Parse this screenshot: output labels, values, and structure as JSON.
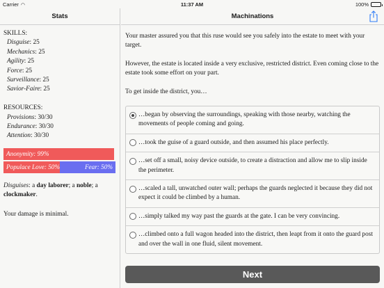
{
  "status_bar": {
    "carrier": "Carrier",
    "time": "11:37 AM",
    "battery": "100%"
  },
  "left": {
    "title": "Stats",
    "skills_title": "SKILLS:",
    "skills": [
      {
        "name": "Disguise",
        "value": ": 25"
      },
      {
        "name": "Mechanics",
        "value": ": 25"
      },
      {
        "name": "Agility",
        "value": ": 25"
      },
      {
        "name": "Force",
        "value": ": 25"
      },
      {
        "name": "Surveillance",
        "value": ": 25"
      },
      {
        "name": "Savior-Faire",
        "value": ": 25"
      }
    ],
    "resources_title": "RESOURCES:",
    "resources": [
      {
        "name": "Provisions",
        "value": ": 30/30"
      },
      {
        "name": "Endurance",
        "value": ": 30/30"
      },
      {
        "name": "Attention",
        "value": ": 30/30"
      }
    ],
    "bars": {
      "anonymity": {
        "label": "Anonymity: 99%",
        "value": 0.99,
        "color": "#f05a5a"
      },
      "populace": {
        "left_label": "Populace Love: 50%",
        "right_label": "Fear: 50%",
        "value": 0.5,
        "left_color": "#f05a5a",
        "right_color": "#6a6ef0"
      }
    },
    "disguises": {
      "prefix": "Disguises",
      "sep1": ": a ",
      "item1": "day laborer",
      "sep2": "; a ",
      "item2": "noble",
      "sep3": "; a ",
      "item3": "clockmaker",
      "end": "."
    },
    "damage": "Your damage is minimal."
  },
  "right": {
    "title": "Machinations",
    "paragraphs": [
      "Your master assured you that this ruse would see you safely into the estate to meet with your target.",
      "However, the estate is located inside a very exclusive, restricted district. Even coming close to the estate took some effort on your part.",
      "To get inside the district, you…"
    ],
    "choices": [
      {
        "text": "…began by observing the surroundings, speaking with those nearby, watching the movements of people coming and going.",
        "selected": true
      },
      {
        "text": "…took the guise of a guard outside, and then assumed his place perfectly.",
        "selected": false
      },
      {
        "text": "…set off a small, noisy device outside, to create a distraction and allow me to slip inside the perimeter.",
        "selected": false
      },
      {
        "text": "…scaled a tall, unwatched outer wall; perhaps the guards neglected it because they did not expect it could be climbed by a human.",
        "selected": false
      },
      {
        "text": "…simply talked my way past the guards at the gate. I can be very convincing.",
        "selected": false
      },
      {
        "text": "…climbed onto a full wagon headed into the district, then leapt from it onto the guard post and over the wall in one fluid, silent movement.",
        "selected": false
      }
    ],
    "next_label": "Next"
  }
}
